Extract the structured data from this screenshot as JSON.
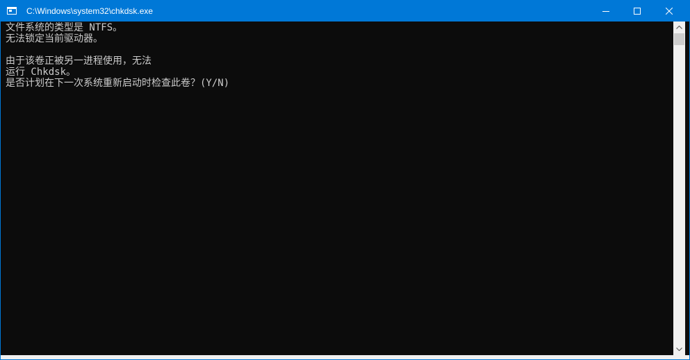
{
  "window": {
    "title": "C:\\Windows\\system32\\chkdsk.exe"
  },
  "console": {
    "lines": [
      "文件系统的类型是 NTFS。",
      "无法锁定当前驱动器。",
      "",
      "由于该卷正被另一进程使用，无法",
      "运行 Chkdsk。",
      "是否计划在下一次系统重新启动时检查此卷？(Y/N)"
    ]
  },
  "colors": {
    "titlebar": "#0078d7",
    "console_bg": "#0c0c0c",
    "console_text": "#cccccc"
  }
}
